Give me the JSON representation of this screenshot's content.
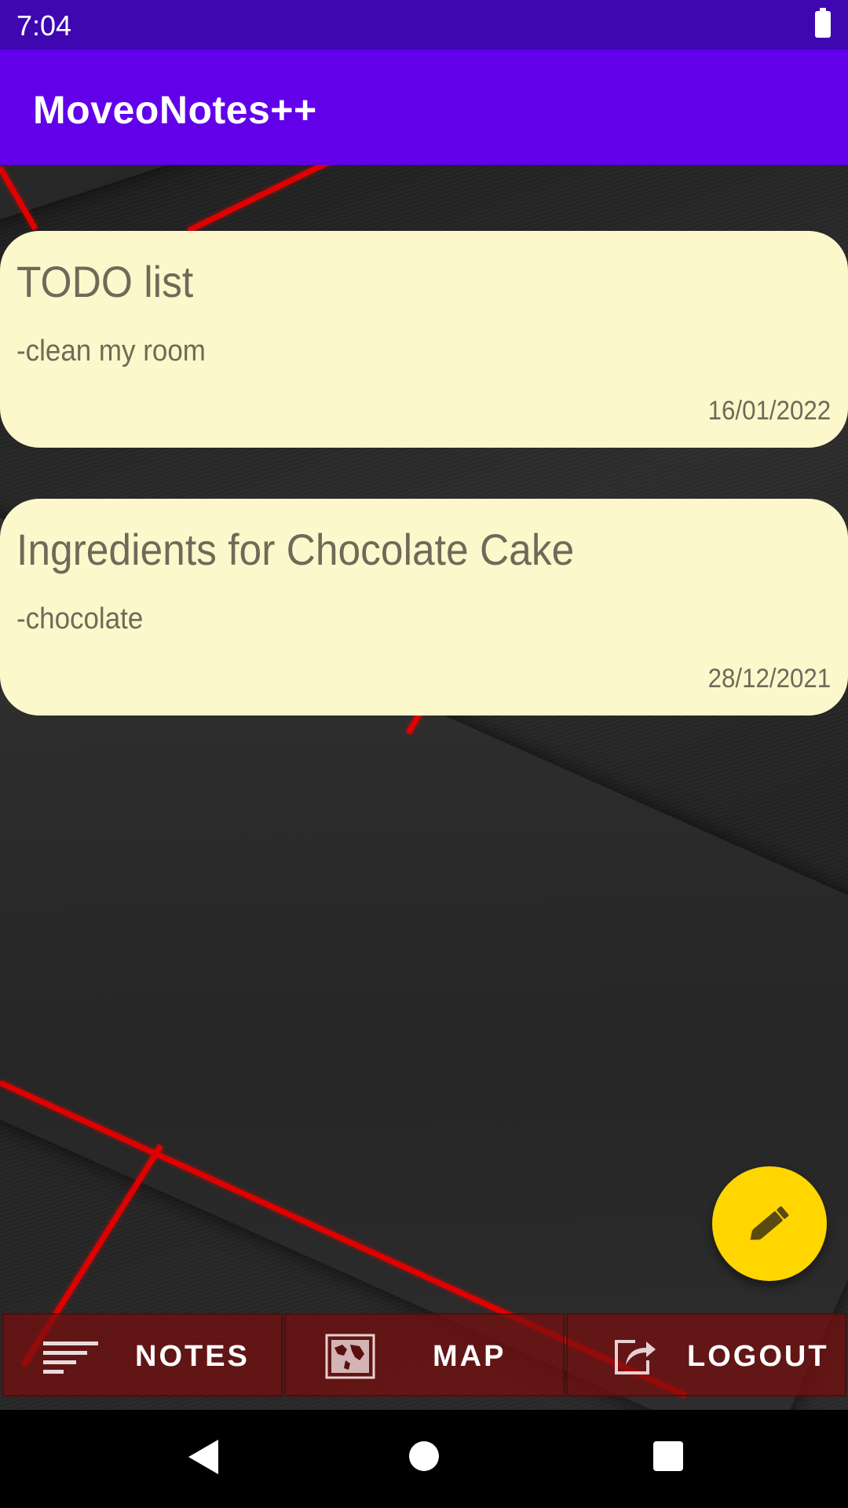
{
  "status_bar": {
    "time": "7:04"
  },
  "app_bar": {
    "title": "MoveoNotes++"
  },
  "notes": [
    {
      "title": "TODO list",
      "body": "-clean my room",
      "date": "16/01/2022"
    },
    {
      "title": "Ingredients for Chocolate Cake",
      "body": "-chocolate",
      "date": "28/12/2021"
    }
  ],
  "fab": {
    "icon": "pencil-icon"
  },
  "bottom_nav": {
    "notes": {
      "label": "NOTES",
      "icon": "list-icon"
    },
    "map": {
      "label": "MAP",
      "icon": "world-map-icon"
    },
    "logout": {
      "label": "LOGOUT",
      "icon": "share-export-icon"
    }
  },
  "colors": {
    "status_bar": "#3e07b0",
    "app_bar": "#6200ea",
    "note_card": "#fdf8cc",
    "fab": "#ffd600",
    "nav_button": "#780e0e"
  }
}
